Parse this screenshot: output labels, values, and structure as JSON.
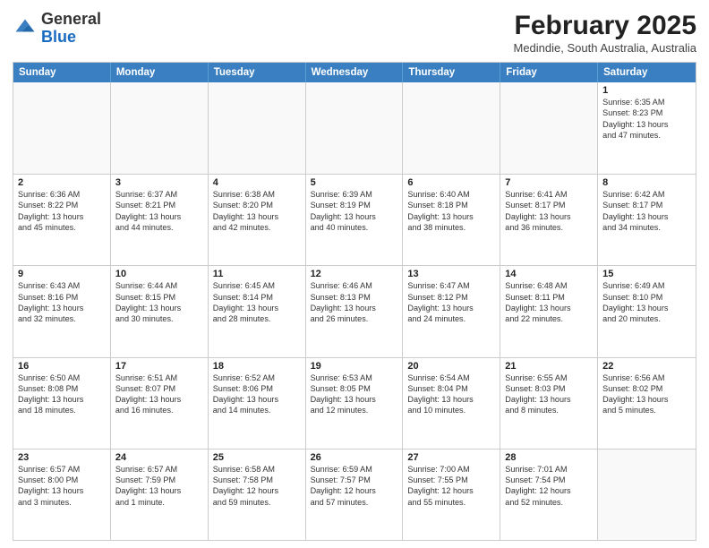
{
  "header": {
    "logo": {
      "line1": "General",
      "line2": "Blue"
    },
    "title": "February 2025",
    "subtitle": "Medindie, South Australia, Australia"
  },
  "days_of_week": [
    "Sunday",
    "Monday",
    "Tuesday",
    "Wednesday",
    "Thursday",
    "Friday",
    "Saturday"
  ],
  "weeks": [
    [
      {
        "day": "",
        "info": ""
      },
      {
        "day": "",
        "info": ""
      },
      {
        "day": "",
        "info": ""
      },
      {
        "day": "",
        "info": ""
      },
      {
        "day": "",
        "info": ""
      },
      {
        "day": "",
        "info": ""
      },
      {
        "day": "1",
        "info": "Sunrise: 6:35 AM\nSunset: 8:23 PM\nDaylight: 13 hours\nand 47 minutes."
      }
    ],
    [
      {
        "day": "2",
        "info": "Sunrise: 6:36 AM\nSunset: 8:22 PM\nDaylight: 13 hours\nand 45 minutes."
      },
      {
        "day": "3",
        "info": "Sunrise: 6:37 AM\nSunset: 8:21 PM\nDaylight: 13 hours\nand 44 minutes."
      },
      {
        "day": "4",
        "info": "Sunrise: 6:38 AM\nSunset: 8:20 PM\nDaylight: 13 hours\nand 42 minutes."
      },
      {
        "day": "5",
        "info": "Sunrise: 6:39 AM\nSunset: 8:19 PM\nDaylight: 13 hours\nand 40 minutes."
      },
      {
        "day": "6",
        "info": "Sunrise: 6:40 AM\nSunset: 8:18 PM\nDaylight: 13 hours\nand 38 minutes."
      },
      {
        "day": "7",
        "info": "Sunrise: 6:41 AM\nSunset: 8:17 PM\nDaylight: 13 hours\nand 36 minutes."
      },
      {
        "day": "8",
        "info": "Sunrise: 6:42 AM\nSunset: 8:17 PM\nDaylight: 13 hours\nand 34 minutes."
      }
    ],
    [
      {
        "day": "9",
        "info": "Sunrise: 6:43 AM\nSunset: 8:16 PM\nDaylight: 13 hours\nand 32 minutes."
      },
      {
        "day": "10",
        "info": "Sunrise: 6:44 AM\nSunset: 8:15 PM\nDaylight: 13 hours\nand 30 minutes."
      },
      {
        "day": "11",
        "info": "Sunrise: 6:45 AM\nSunset: 8:14 PM\nDaylight: 13 hours\nand 28 minutes."
      },
      {
        "day": "12",
        "info": "Sunrise: 6:46 AM\nSunset: 8:13 PM\nDaylight: 13 hours\nand 26 minutes."
      },
      {
        "day": "13",
        "info": "Sunrise: 6:47 AM\nSunset: 8:12 PM\nDaylight: 13 hours\nand 24 minutes."
      },
      {
        "day": "14",
        "info": "Sunrise: 6:48 AM\nSunset: 8:11 PM\nDaylight: 13 hours\nand 22 minutes."
      },
      {
        "day": "15",
        "info": "Sunrise: 6:49 AM\nSunset: 8:10 PM\nDaylight: 13 hours\nand 20 minutes."
      }
    ],
    [
      {
        "day": "16",
        "info": "Sunrise: 6:50 AM\nSunset: 8:08 PM\nDaylight: 13 hours\nand 18 minutes."
      },
      {
        "day": "17",
        "info": "Sunrise: 6:51 AM\nSunset: 8:07 PM\nDaylight: 13 hours\nand 16 minutes."
      },
      {
        "day": "18",
        "info": "Sunrise: 6:52 AM\nSunset: 8:06 PM\nDaylight: 13 hours\nand 14 minutes."
      },
      {
        "day": "19",
        "info": "Sunrise: 6:53 AM\nSunset: 8:05 PM\nDaylight: 13 hours\nand 12 minutes."
      },
      {
        "day": "20",
        "info": "Sunrise: 6:54 AM\nSunset: 8:04 PM\nDaylight: 13 hours\nand 10 minutes."
      },
      {
        "day": "21",
        "info": "Sunrise: 6:55 AM\nSunset: 8:03 PM\nDaylight: 13 hours\nand 8 minutes."
      },
      {
        "day": "22",
        "info": "Sunrise: 6:56 AM\nSunset: 8:02 PM\nDaylight: 13 hours\nand 5 minutes."
      }
    ],
    [
      {
        "day": "23",
        "info": "Sunrise: 6:57 AM\nSunset: 8:00 PM\nDaylight: 13 hours\nand 3 minutes."
      },
      {
        "day": "24",
        "info": "Sunrise: 6:57 AM\nSunset: 7:59 PM\nDaylight: 13 hours\nand 1 minute."
      },
      {
        "day": "25",
        "info": "Sunrise: 6:58 AM\nSunset: 7:58 PM\nDaylight: 12 hours\nand 59 minutes."
      },
      {
        "day": "26",
        "info": "Sunrise: 6:59 AM\nSunset: 7:57 PM\nDaylight: 12 hours\nand 57 minutes."
      },
      {
        "day": "27",
        "info": "Sunrise: 7:00 AM\nSunset: 7:55 PM\nDaylight: 12 hours\nand 55 minutes."
      },
      {
        "day": "28",
        "info": "Sunrise: 7:01 AM\nSunset: 7:54 PM\nDaylight: 12 hours\nand 52 minutes."
      },
      {
        "day": "",
        "info": ""
      }
    ]
  ]
}
